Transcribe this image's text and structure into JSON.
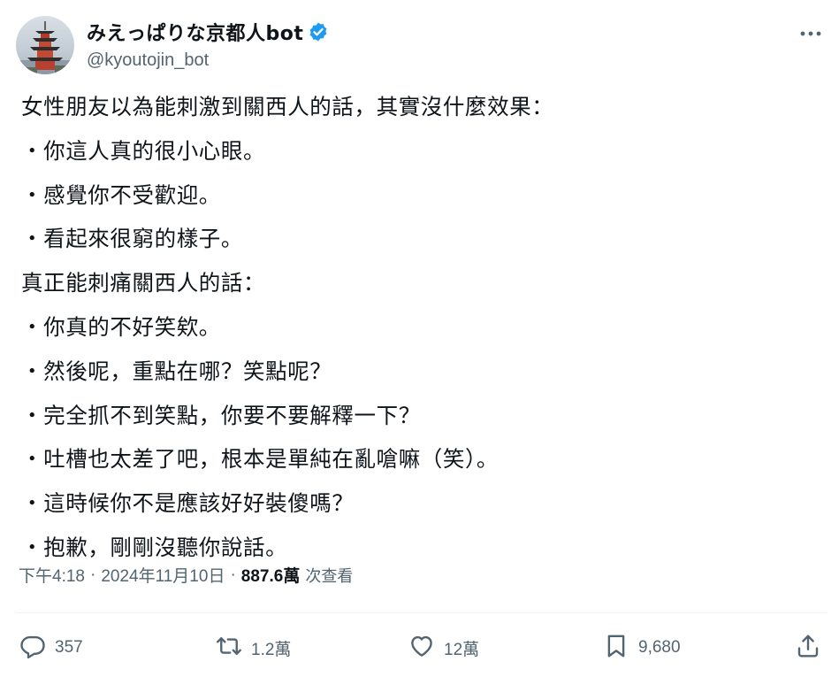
{
  "author": {
    "display_name": "みえっぱりな京都人bot",
    "handle": "@kyoutojin_bot",
    "avatar_icon": "pagoda-avatar-icon",
    "verified_icon": "verified-badge-icon",
    "verified_color": "#1d9bf0"
  },
  "tweet": {
    "lines": [
      "女性朋友以為能刺激到關西人的話，其實沒什麼效果：",
      "・你這人真的很小心眼。",
      "・感覺你不受歡迎。",
      "・看起來很窮的樣子。",
      "真正能刺痛關西人的話：",
      "・你真的不好笑欸。",
      "・然後呢，重點在哪？笑點呢？",
      "・完全抓不到笑點，你要不要解釋一下？",
      "・吐槽也太差了吧，根本是單純在亂嗆嘛（笑）。",
      "・這時候你不是應該好好裝傻嗎？",
      "・抱歉，剛剛沒聽你說話。"
    ]
  },
  "meta": {
    "time": "下午4:18",
    "date": "2024年11月10日",
    "views_count": "887.6萬",
    "views_label": "次查看"
  },
  "actions": {
    "reply_count": "357",
    "retweet_count": "1.2萬",
    "like_count": "12萬",
    "bookmark_count": "9,680"
  },
  "colors": {
    "text": "#0f1419",
    "secondary": "#536471",
    "divider": "#eff3f4"
  }
}
